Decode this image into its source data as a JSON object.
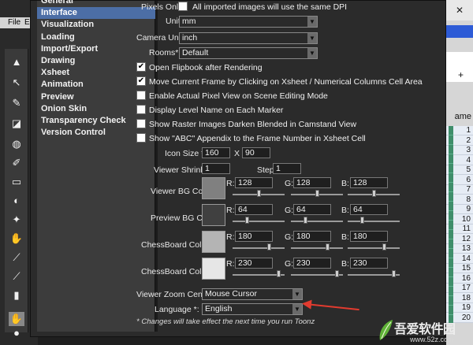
{
  "app": {
    "menu": [
      "File",
      "Ed"
    ],
    "close_glyph": "✕",
    "timeline_header": "ame",
    "plus": "+",
    "row_numbers": [
      "1",
      "2",
      "3",
      "4",
      "5",
      "6",
      "7",
      "8",
      "9",
      "10",
      "11",
      "12",
      "13",
      "14",
      "15",
      "16",
      "17",
      "18",
      "19",
      "20"
    ]
  },
  "categories": [
    {
      "label": "General",
      "selected": false
    },
    {
      "label": "Interface",
      "selected": true
    },
    {
      "label": "Visualization",
      "selected": false
    },
    {
      "label": "Loading",
      "selected": false
    },
    {
      "label": "Import/Export",
      "selected": false
    },
    {
      "label": "Drawing",
      "selected": false
    },
    {
      "label": "Xsheet",
      "selected": false
    },
    {
      "label": "Animation",
      "selected": false
    },
    {
      "label": "Preview",
      "selected": false
    },
    {
      "label": "Onion Skin",
      "selected": false
    },
    {
      "label": "Transparency Check",
      "selected": false
    },
    {
      "label": "Version Control",
      "selected": false
    }
  ],
  "settings": {
    "pixels_only_label": "Pixels Only:",
    "pixels_only_text": "All imported images will use the same DPI",
    "unit_label": "Unit:",
    "unit_value": "mm",
    "camera_unit_label": "Camera Unit:",
    "camera_unit_value": "inch",
    "rooms_label": "Rooms*:",
    "rooms_value": "Default",
    "checkboxes": [
      {
        "label": "Open Flipbook after Rendering",
        "checked": true
      },
      {
        "label": "Move Current Frame by Clicking on Xsheet / Numerical Columns Cell Area",
        "checked": true
      },
      {
        "label": "Enable Actual Pixel View on Scene Editing Mode",
        "checked": false
      },
      {
        "label": "Display Level Name on Each Marker",
        "checked": false
      },
      {
        "label": "Show Raster Images Darken Blended in Camstand View",
        "checked": false
      },
      {
        "label": "Show \"ABC\" Appendix to the Frame Number in Xsheet Cell",
        "checked": false
      }
    ],
    "icon_size_label": "Icon Size *",
    "icon_size_w": "160",
    "icon_size_x": "X",
    "icon_size_h": "90",
    "viewer_shrink_label": "Viewer  Shrink",
    "viewer_shrink_value": "1",
    "step_label": "Step",
    "step_value": "1",
    "colors": [
      {
        "label": "Viewer BG Color",
        "swatch": "#808080",
        "r": "128",
        "g": "128",
        "b": "128"
      },
      {
        "label": "Preview BG Color",
        "swatch": "#404040",
        "r": "64",
        "g": "64",
        "b": "64"
      },
      {
        "label": "ChessBoard Color 1",
        "swatch": "#b4b4b4",
        "r": "180",
        "g": "180",
        "b": "180"
      },
      {
        "label": "ChessBoard Color 2",
        "swatch": "#e6e6e6",
        "r": "230",
        "g": "230",
        "b": "230"
      }
    ],
    "channel_r": "R:",
    "channel_g": "G:",
    "channel_b": "B:",
    "viewer_zoom_label": "Viewer Zoom Center",
    "viewer_zoom_value": "Mouse Cursor",
    "language_label": "Language *:",
    "language_value": "English",
    "footnote": "* Changes will take effect the next time you run Toonz"
  },
  "watermark": {
    "text": "吾爱软件园",
    "sub": "www.52z.com"
  }
}
